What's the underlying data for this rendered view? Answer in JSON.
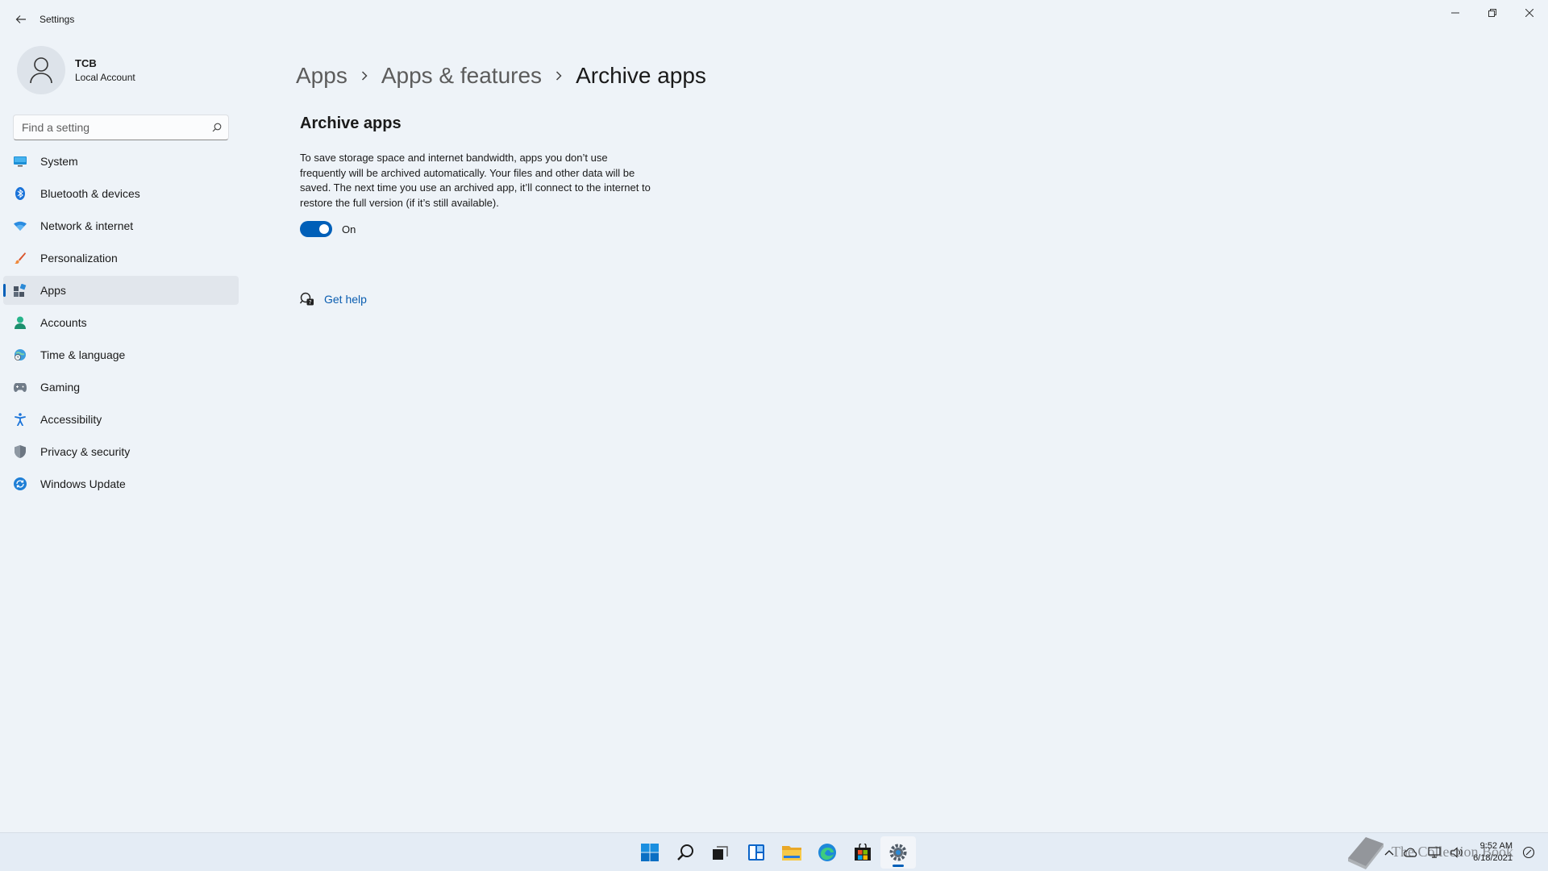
{
  "window": {
    "title": "Settings",
    "controls": [
      "minimize",
      "restore",
      "close"
    ]
  },
  "profile": {
    "name": "TCB",
    "account_type": "Local Account"
  },
  "search": {
    "placeholder": "Find a setting"
  },
  "nav": {
    "items": [
      {
        "label": "System",
        "icon": "monitor-icon"
      },
      {
        "label": "Bluetooth & devices",
        "icon": "bluetooth-icon"
      },
      {
        "label": "Network & internet",
        "icon": "wifi-icon"
      },
      {
        "label": "Personalization",
        "icon": "brush-icon"
      },
      {
        "label": "Apps",
        "icon": "apps-icon",
        "active": true
      },
      {
        "label": "Accounts",
        "icon": "person-icon"
      },
      {
        "label": "Time & language",
        "icon": "globe-clock-icon"
      },
      {
        "label": "Gaming",
        "icon": "gamepad-icon"
      },
      {
        "label": "Accessibility",
        "icon": "accessibility-icon"
      },
      {
        "label": "Privacy & security",
        "icon": "shield-icon"
      },
      {
        "label": "Windows Update",
        "icon": "update-icon"
      }
    ]
  },
  "breadcrumb": {
    "items": [
      "Apps",
      "Apps & features",
      "Archive apps"
    ]
  },
  "section": {
    "title": "Archive apps",
    "description": "To save storage space and internet bandwidth, apps you don’t use frequently will be archived automatically. Your files and other data will be saved. The next time you use an archived app, it’ll connect to the internet to restore the full version (if it’s still available).",
    "toggle": {
      "state": "On",
      "enabled": true
    }
  },
  "help": {
    "label": "Get help"
  },
  "taskbar": {
    "apps": [
      "start-icon",
      "search-icon",
      "task-view-icon",
      "widgets-icon",
      "file-explorer-icon",
      "edge-icon",
      "store-icon",
      "settings-icon"
    ],
    "active_app": "settings-icon",
    "clock": {
      "time": "9:52 AM",
      "date": "6/18/2021"
    }
  },
  "watermark": {
    "text": "The Collection Book"
  },
  "colors": {
    "accent": "#005fb8",
    "background": "#eef3f8",
    "link": "#0a5db0"
  }
}
